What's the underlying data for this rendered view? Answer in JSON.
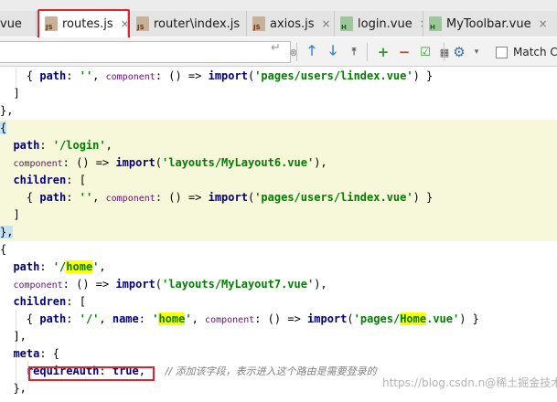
{
  "tabs": [
    {
      "label": "vue",
      "icon": "vue-file-icon",
      "active": false
    },
    {
      "label": "routes.js",
      "icon": "js-file-icon",
      "active": true
    },
    {
      "label": "router\\index.js",
      "icon": "js-file-icon",
      "active": false
    },
    {
      "label": "axios.js",
      "icon": "js-file-icon",
      "active": false
    },
    {
      "label": "login.vue",
      "icon": "vue-file-icon",
      "active": false
    },
    {
      "label": "MyToolbar.vue",
      "icon": "vue-file-icon",
      "active": false
    }
  ],
  "search": {
    "value": "",
    "match_case_label": "Match Ca"
  },
  "code": {
    "l1": {
      "a": "{ ",
      "b": "path",
      "c": ": ",
      "d": "''",
      "e": ", ",
      "f": "component",
      "g": ": () => ",
      "h": "import",
      "i": "(",
      "j": "'pages/users/lindex.vue'",
      "k": ") }"
    },
    "l2": "]",
    "l3": "},",
    "l4": "{",
    "l5": {
      "b": "path",
      "c": ": ",
      "d": "'/login'",
      "e": ","
    },
    "l6": {
      "f": "component",
      "g": ": () => ",
      "h": "import",
      "i": "(",
      "j": "'layouts/MyLayout6.vue'",
      "k": "),"
    },
    "l7": {
      "b": "children",
      "c": ": ["
    },
    "l8": {
      "a": "{ ",
      "b": "path",
      "c": ": ",
      "d": "''",
      "e": ", ",
      "f": "component",
      "g": ": () => ",
      "h": "import",
      "i": "(",
      "j": "'pages/users/lindex.vue'",
      "k": ") }"
    },
    "l9": "]",
    "l10": "},",
    "l11": "{",
    "l12": {
      "b": "path",
      "c": ": ",
      "d1": "'/",
      "d2": "home",
      "d3": "'",
      "e": ","
    },
    "l13": {
      "f": "component",
      "g": ": () => ",
      "h": "import",
      "i": "(",
      "j": "'layouts/MyLayout7.vue'",
      "k": "),"
    },
    "l14": {
      "b": "children",
      "c": ": ["
    },
    "l15": {
      "a": "{ ",
      "b": "path",
      "c": ": ",
      "d": "'/'",
      "e": ", ",
      "n": "name",
      "n2": ": ",
      "s1": "'",
      "s2": "home",
      "s3": "'",
      "e2": ", ",
      "f": "component",
      "g": ": () => ",
      "h": "import",
      "i": "(",
      "j1": "'pages/",
      "j2": "Home",
      "j3": ".vue'",
      "k": ") }"
    },
    "l16": "],",
    "l17": {
      "b": "meta",
      "c": ": {"
    },
    "l18": {
      "b": "requireAuth",
      "c": ": ",
      "t": "true",
      "e": ",",
      "cm": "// 添加该字段，表示进入这个路由是需要登录的"
    },
    "l19": "},"
  },
  "watermark": "https://blog.csdn.n@稀土掘金技术社区"
}
